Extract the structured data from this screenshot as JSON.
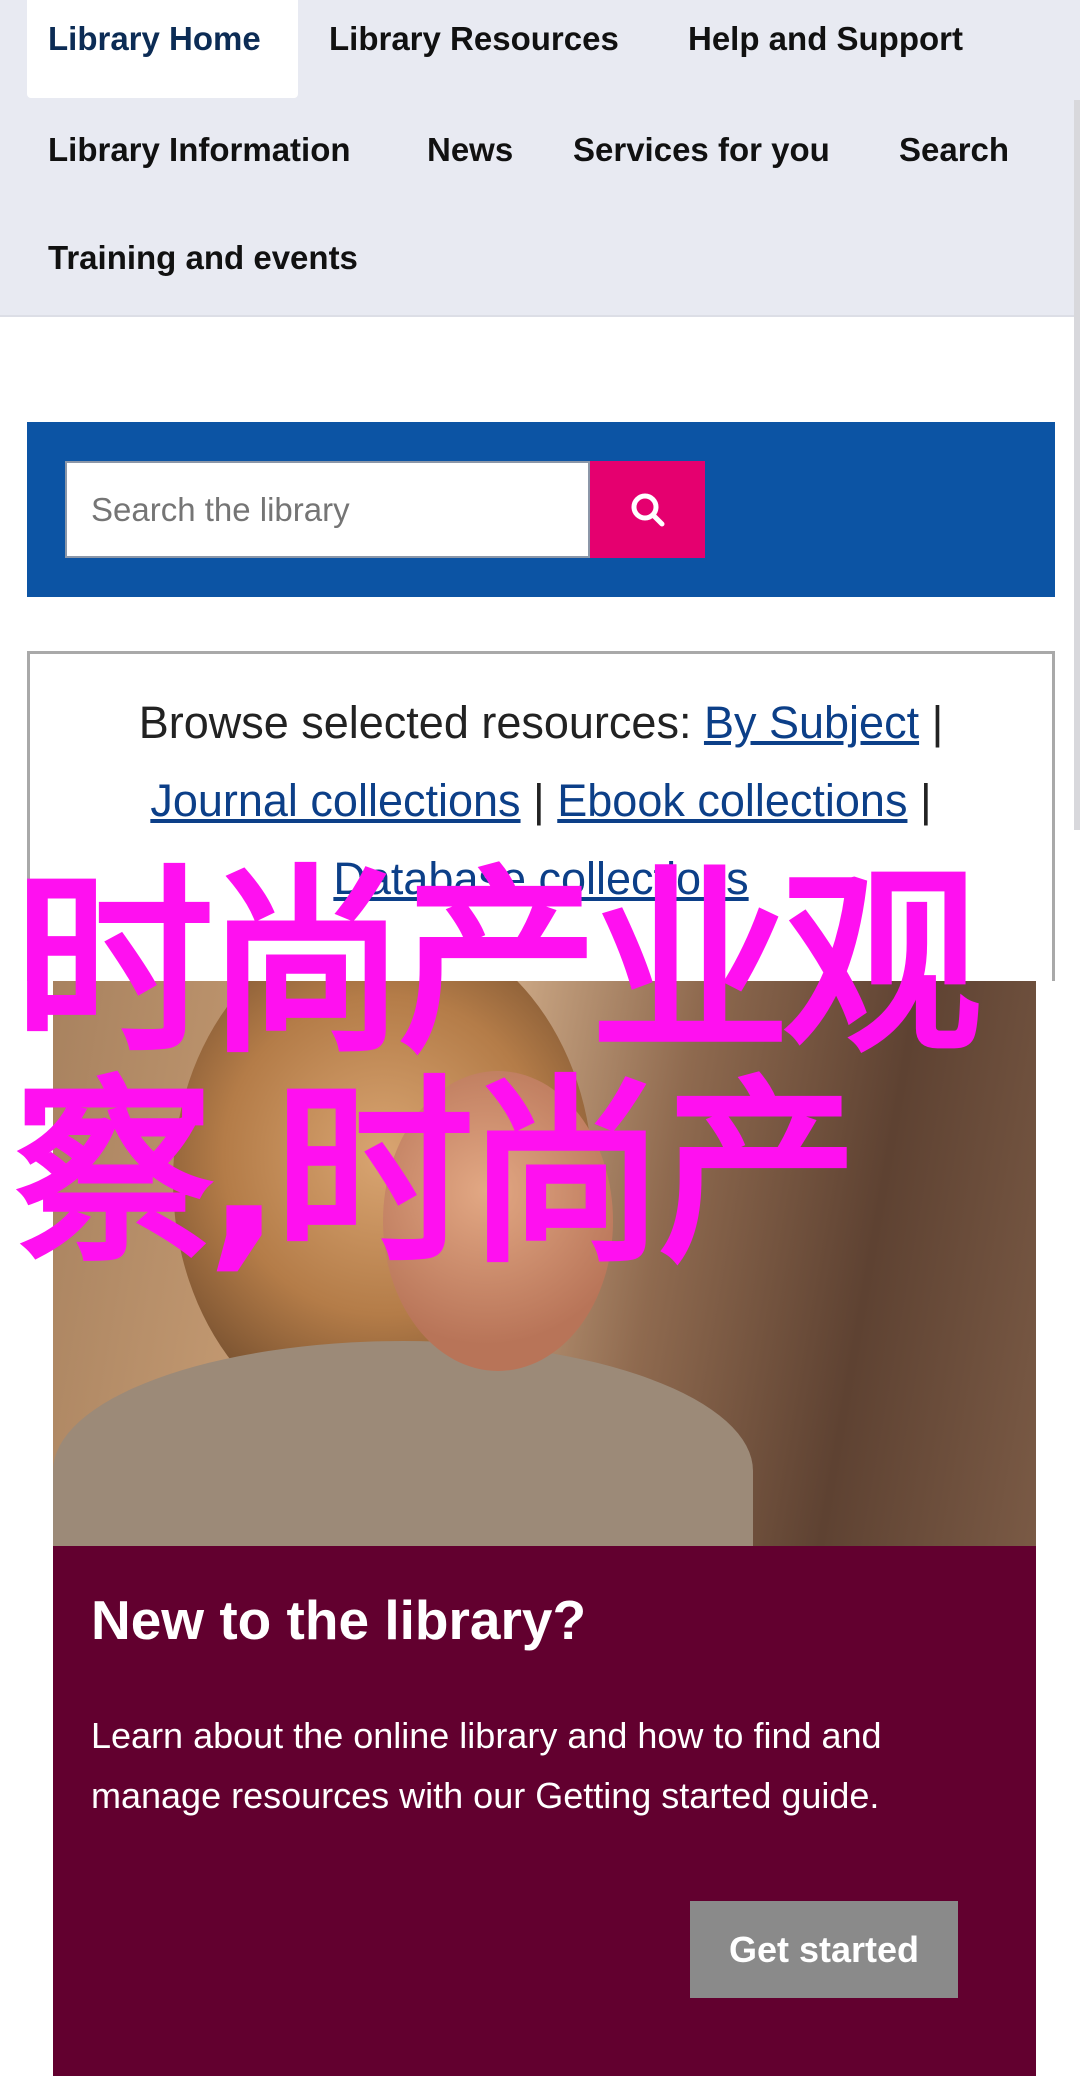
{
  "nav": {
    "items": [
      "Library Home",
      "Library Resources",
      "Help and Support",
      "Library Information",
      "News",
      "Services for you",
      "Search",
      "Training and events"
    ],
    "active": "Library Home"
  },
  "search": {
    "placeholder": "Search the library",
    "button_icon": "search-icon"
  },
  "browse": {
    "prefix": "Browse selected resources: ",
    "links": [
      "By Subject",
      "Journal collections",
      "Ebook collections",
      "Database collections"
    ],
    "separator": " | "
  },
  "overlay_text": "时尚产业观察,时尚产",
  "card": {
    "title": "New to the library?",
    "body": "Learn about the online library and how to find and manage resources with our Getting started guide.",
    "button": "Get started"
  },
  "colors": {
    "nav_bg": "#e8eaf2",
    "search_panel": "#0c54a4",
    "search_button": "#e5006f",
    "card_bg": "#62002f",
    "link": "#0c3f88",
    "overlay": "#ff10f0"
  }
}
